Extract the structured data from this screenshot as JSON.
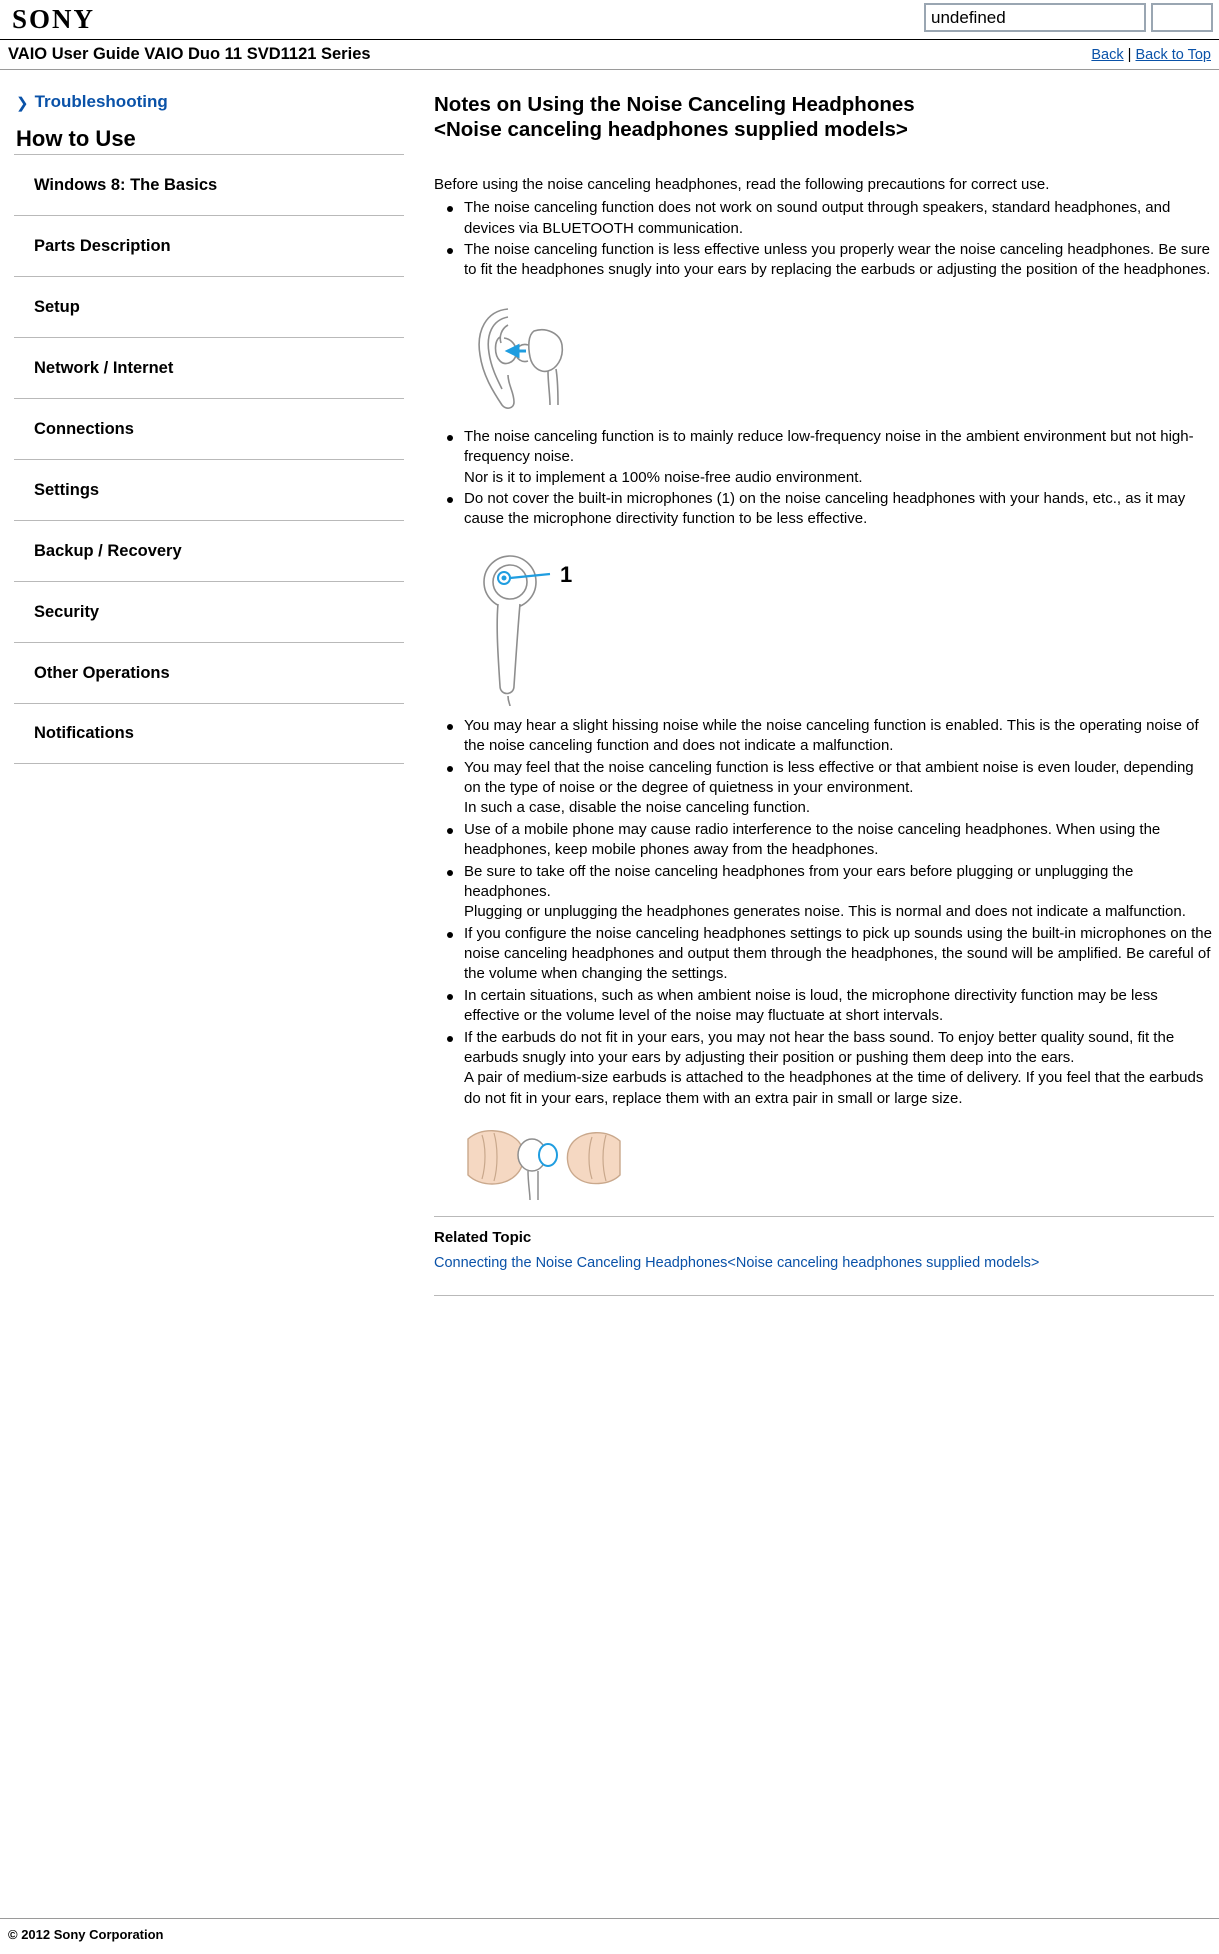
{
  "browser": {
    "logo_text": "SONY",
    "address_value": "undefined",
    "address_placeholder": "",
    "go_button_label": ""
  },
  "guide_header": {
    "title": "VAIO User Guide VAIO Duo 11 SVD1121 Series",
    "back_label": "Back",
    "separator": "|",
    "back_to_top_label": "Back to Top"
  },
  "sidebar": {
    "troubleshooting_label": "Troubleshooting",
    "chevron": "❯",
    "section_title": "How to Use",
    "items": [
      {
        "label": "Windows 8: The Basics"
      },
      {
        "label": "Parts Description"
      },
      {
        "label": "Setup"
      },
      {
        "label": "Network / Internet"
      },
      {
        "label": "Connections"
      },
      {
        "label": "Settings"
      },
      {
        "label": "Backup / Recovery"
      },
      {
        "label": "Security"
      },
      {
        "label": "Other Operations"
      },
      {
        "label": "Notifications"
      }
    ]
  },
  "article": {
    "title_line1": "Notes on Using the Noise Canceling Headphones",
    "title_line2": "<Noise canceling headphones supplied models>",
    "intro": "Before using the noise canceling headphones, read the following precautions for correct use.",
    "bullets_group1": [
      "The noise canceling function does not work on sound output through speakers, standard headphones, and devices via BLUETOOTH communication.",
      "The noise canceling function is less effective unless you properly wear the noise canceling headphones. Be sure to fit the headphones snugly into your ears by replacing the earbuds or adjusting the position of the headphones."
    ],
    "figure1_alt": "Illustration of an ear with a noise canceling earbud headphone",
    "bullets_group2": [
      "The noise canceling function is to mainly reduce low-frequency noise in the ambient environment but not high-frequency noise.\nNor is it to implement a 100% noise-free audio environment.",
      "Do not cover the built-in microphones (1) on the noise canceling headphones with your hands, etc., as it may cause the microphone directivity function to be less effective."
    ],
    "figure2_alt": "Illustration of an earbud headphone with callout number 1 pointing to the built-in microphone",
    "figure2_callout": "1",
    "bullets_group3": [
      "You may hear a slight hissing noise while the noise canceling function is enabled. This is the operating noise of the noise canceling function and does not indicate a malfunction.",
      "You may feel that the noise canceling function is less effective or that ambient noise is even louder, depending on the type of noise or the degree of quietness in your environment.\nIn such a case, disable the noise canceling function.",
      "Use of a mobile phone may cause radio interference to the noise canceling headphones. When using the headphones, keep mobile phones away from the headphones.",
      "Be sure to take off the noise canceling headphones from your ears before plugging or unplugging the headphones.\nPlugging or unplugging the headphones generates noise. This is normal and does not indicate a malfunction.",
      "If you configure the noise canceling headphones settings to pick up sounds using the built-in microphones on the noise canceling headphones and output them through the headphones, the sound will be amplified. Be careful of the volume when changing the settings.",
      "In certain situations, such as when ambient noise is loud, the microphone directivity function may be less effective or the volume level of the noise may fluctuate at short intervals.",
      "If the earbuds do not fit in your ears, you may not hear the bass sound. To enjoy better quality sound, fit the earbuds snugly into your ears by adjusting their position or pushing them deep into the ears.\nA pair of medium-size earbuds is attached to the headphones at the time of delivery. If you feel that the earbuds do not fit in your ears, replace them with an extra pair in small or large size."
    ],
    "figure3_alt": "Illustration of two hands replacing the earbud on a headphone",
    "related_title": "Related Topic",
    "related_link": "Connecting the Noise Canceling Headphones<Noise canceling headphones supplied models>"
  },
  "footer": {
    "copyright": "© 2012 Sony Corporation"
  },
  "colors": {
    "link": "#0a52a8",
    "rule": "#b9b9b9",
    "figure_line": "#9a9a9a",
    "figure_accent": "#1f9de0",
    "skin": "#f5d8c2"
  }
}
